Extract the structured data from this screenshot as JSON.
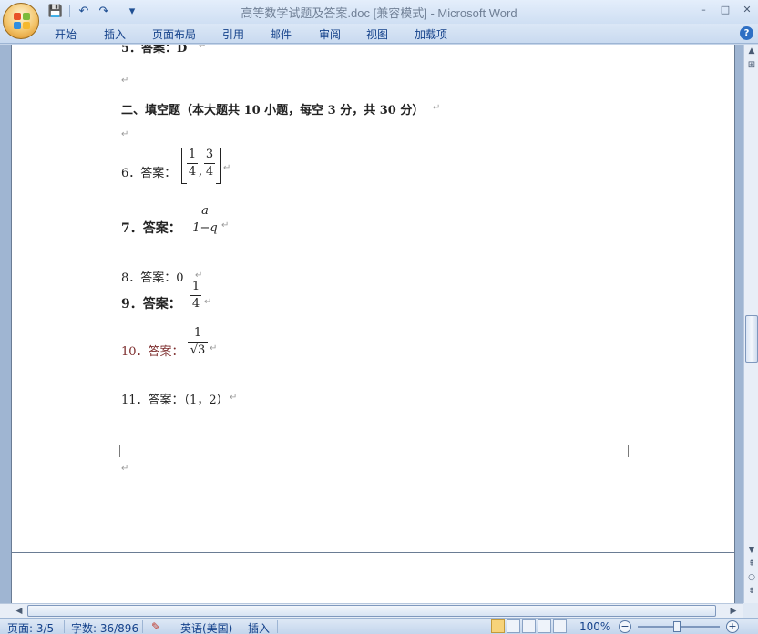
{
  "window": {
    "title": "高等数学试题及答案.doc [兼容模式] - Microsoft Word",
    "controls": [
      "–",
      "□",
      "✕"
    ]
  },
  "quick_access": {
    "save": "💾",
    "undo": "↶",
    "redo": "↷",
    "customize": "▾"
  },
  "ribbon": {
    "tabs": [
      "开始",
      "插入",
      "页面布局",
      "引用",
      "邮件",
      "审阅",
      "视图",
      "加载项"
    ],
    "help": "?"
  },
  "document": {
    "line5": "5．答案：D",
    "section_heading": "二、填空题（本大题共 10 小题，每空 3 分，共 30 分）",
    "q6_label": "6．答案：",
    "q6_frac1": {
      "num": "1",
      "den": "4"
    },
    "q6_frac2": {
      "num": "3",
      "den": "4"
    },
    "q6_comma": ",",
    "q7_label": "7．答案：",
    "q7_frac": {
      "num": "a",
      "den": "1−q"
    },
    "q8_label": "8．答案：0",
    "q9_label": "9．答案：",
    "q9_frac": {
      "num": "1",
      "den": "4"
    },
    "q10_label": "10．答案：",
    "q10_frac": {
      "num": "1",
      "den": "√3"
    },
    "q11_label": "11．答案：（1，2）",
    "para_mark": "↵"
  },
  "statusbar": {
    "page": "页面: 3/5",
    "words": "字数: 36/896",
    "language": "英语(美国)",
    "mode": "插入",
    "zoom": "100%",
    "zoom_minus": "−",
    "zoom_plus": "+"
  },
  "colors": {
    "accent": "#15428b",
    "ribbon": "#c9daf0"
  }
}
